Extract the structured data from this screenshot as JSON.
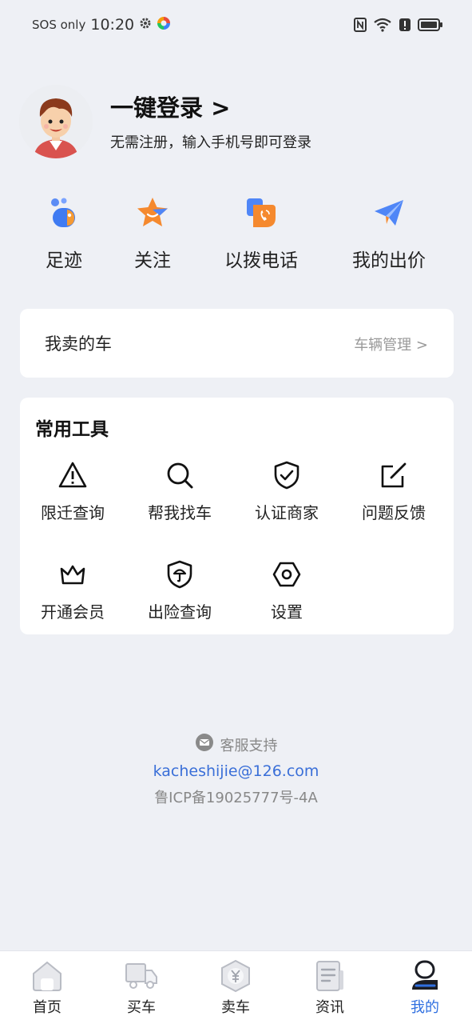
{
  "status_bar": {
    "sos": "SOS only",
    "time": "10:20",
    "icons": [
      "gear-icon",
      "color-logo-icon",
      "nfc-icon",
      "wifi-icon",
      "alert-icon",
      "battery-icon"
    ]
  },
  "profile": {
    "title": "一键登录 >",
    "subtitle": "无需注册，输入手机号即可登录"
  },
  "quick_actions": [
    {
      "label": "足迹",
      "icon": "footprint-icon"
    },
    {
      "label": "关注",
      "icon": "star-icon"
    },
    {
      "label": "以拨电话",
      "icon": "phone-icon"
    },
    {
      "label": "我的出价",
      "icon": "paper-plane-icon"
    }
  ],
  "sell_card": {
    "title": "我卖的车",
    "manage": "车辆管理 >"
  },
  "tools": {
    "title": "常用工具",
    "items": [
      {
        "label": "限迁查询",
        "icon": "warning-icon"
      },
      {
        "label": "帮我找车",
        "icon": "search-icon"
      },
      {
        "label": "认证商家",
        "icon": "shield-check-icon"
      },
      {
        "label": "问题反馈",
        "icon": "edit-icon"
      },
      {
        "label": "开通会员",
        "icon": "crown-icon"
      },
      {
        "label": "出险查询",
        "icon": "shield-umbrella-icon"
      },
      {
        "label": "设置",
        "icon": "settings-icon"
      }
    ]
  },
  "support": {
    "label": "客服支持",
    "email": "kacheshijie@126.com",
    "icp": "鲁ICP备19025777号-4A"
  },
  "tabbar": [
    {
      "label": "首页",
      "icon": "home-icon",
      "active": false
    },
    {
      "label": "买车",
      "icon": "truck-icon",
      "active": false
    },
    {
      "label": "卖车",
      "icon": "yen-hex-icon",
      "active": false
    },
    {
      "label": "资讯",
      "icon": "news-icon",
      "active": false
    },
    {
      "label": "我的",
      "icon": "profile-icon",
      "active": true
    }
  ],
  "colors": {
    "background": "#eef0f5",
    "accent": "#2f6fe0",
    "email_link": "#3a6fd8",
    "muted": "#888888"
  }
}
